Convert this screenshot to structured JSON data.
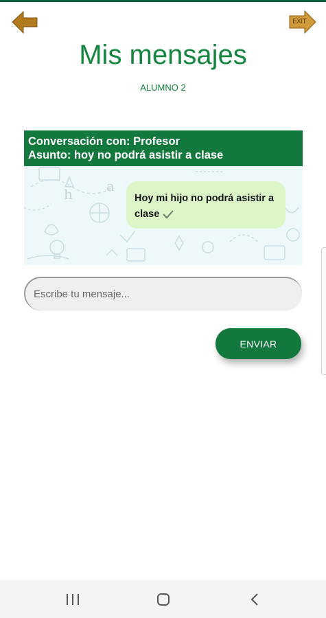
{
  "header": {
    "back_icon": "back-arrow-icon",
    "exit_icon": "exit-arrow-icon",
    "exit_text": "EXIT",
    "title": "Mis mensajes",
    "subtitle": "ALUMNO 2"
  },
  "conversation": {
    "with_line": "Conversación con: Profesor",
    "subject_line": "Asunto: hoy no podrá asistir a clase",
    "messages": [
      {
        "text": "Hoy mi hijo no podrá asistir a clase",
        "status_icon": "checkmark-icon"
      }
    ]
  },
  "composer": {
    "placeholder": "Escribe tu mensaje...",
    "send_label": "ENVIAR"
  },
  "nav": {
    "recents_icon": "recents-icon",
    "home_icon": "home-icon",
    "back_icon": "nav-back-icon"
  },
  "colors": {
    "brand_green": "#13783d",
    "title_green": "#14853f",
    "arrow_gold": "#b07a1d",
    "bubble_green": "#dcf6c8"
  }
}
